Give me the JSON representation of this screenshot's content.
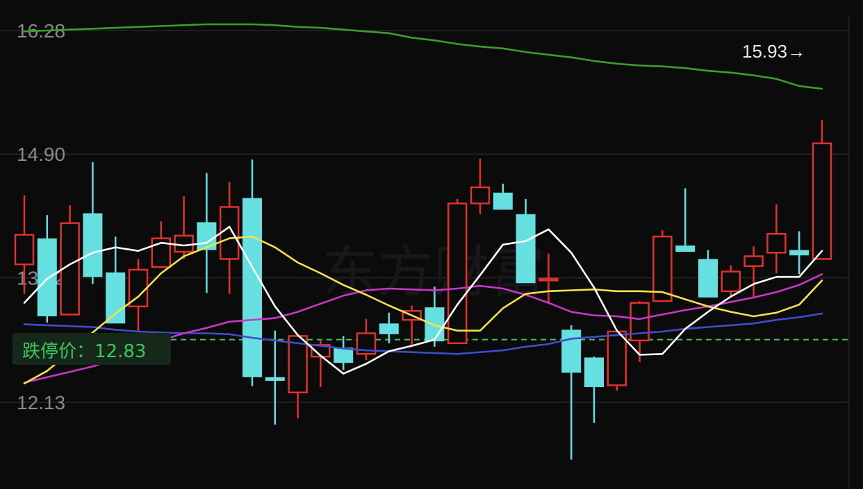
{
  "top_values": [
    {
      "text": "",
      "color": "#3cc85a"
    },
    {
      "text": "",
      "color": "#e6e6e6"
    },
    {
      "text": "",
      "color": "#4a5bff"
    }
  ],
  "limit_line": {
    "label": "跌停价：12.83",
    "value": 12.83,
    "color": "#3cc85a"
  },
  "last_price": {
    "label": "15.93→",
    "value": 15.93
  },
  "watermark": "东方财富",
  "colors": {
    "up": "#e0322b",
    "down": "#66dfe0",
    "ma5": "#ffffff",
    "ma10": "#f5e24a",
    "ma20": "#c837c8",
    "ma60": "#3f4ccc",
    "ma_long": "#3a9e2a",
    "grid": "#262629"
  },
  "chart_data": {
    "type": "candlestick",
    "y_ticks": [
      "16.28",
      "14.90",
      "13.52",
      "12.13"
    ],
    "y_tick_values": [
      16.28,
      14.9,
      13.52,
      12.13
    ],
    "ylim": [
      11.5,
      16.55
    ],
    "grid": true,
    "candles": [
      {
        "o": 13.67,
        "h": 14.44,
        "l": 13.34,
        "c": 14.0,
        "dir": "up"
      },
      {
        "o": 13.96,
        "h": 14.22,
        "l": 13.02,
        "c": 13.09,
        "dir": "down"
      },
      {
        "o": 13.11,
        "h": 14.33,
        "l": 13.11,
        "c": 14.13,
        "dir": "up"
      },
      {
        "o": 14.24,
        "h": 14.81,
        "l": 13.45,
        "c": 13.53,
        "dir": "down"
      },
      {
        "o": 13.58,
        "h": 13.98,
        "l": 13.03,
        "c": 13.01,
        "dir": "down"
      },
      {
        "o": 13.2,
        "h": 13.73,
        "l": 12.92,
        "c": 13.61,
        "dir": "up"
      },
      {
        "o": 13.64,
        "h": 14.15,
        "l": 13.64,
        "c": 13.96,
        "dir": "up"
      },
      {
        "o": 13.81,
        "h": 14.43,
        "l": 13.73,
        "c": 13.99,
        "dir": "up"
      },
      {
        "o": 14.14,
        "h": 14.69,
        "l": 13.35,
        "c": 13.83,
        "dir": "down"
      },
      {
        "o": 13.73,
        "h": 14.59,
        "l": 13.34,
        "c": 14.31,
        "dir": "up"
      },
      {
        "o": 14.41,
        "h": 14.84,
        "l": 12.31,
        "c": 12.41,
        "dir": "down"
      },
      {
        "o": 12.41,
        "h": 12.93,
        "l": 11.88,
        "c": 12.37,
        "dir": "down"
      },
      {
        "o": 12.24,
        "h": 12.89,
        "l": 11.95,
        "c": 12.87,
        "dir": "up"
      },
      {
        "o": 12.64,
        "h": 12.83,
        "l": 12.3,
        "c": 12.77,
        "dir": "up"
      },
      {
        "o": 12.74,
        "h": 12.87,
        "l": 12.49,
        "c": 12.57,
        "dir": "down"
      },
      {
        "o": 12.67,
        "h": 13.06,
        "l": 12.6,
        "c": 12.9,
        "dir": "up"
      },
      {
        "o": 13.01,
        "h": 13.13,
        "l": 12.79,
        "c": 12.89,
        "dir": "down"
      },
      {
        "o": 13.05,
        "h": 13.21,
        "l": 12.76,
        "c": 13.15,
        "dir": "up"
      },
      {
        "o": 12.81,
        "h": 13.42,
        "l": 12.75,
        "c": 13.19,
        "dir": "down"
      },
      {
        "o": 12.79,
        "h": 14.4,
        "l": 12.79,
        "c": 14.35,
        "dir": "up"
      },
      {
        "o": 14.35,
        "h": 14.85,
        "l": 14.23,
        "c": 14.53,
        "dir": "up"
      },
      {
        "o": 14.47,
        "h": 14.57,
        "l": 14.28,
        "c": 14.28,
        "dir": "down"
      },
      {
        "o": 14.23,
        "h": 14.4,
        "l": 13.46,
        "c": 13.46,
        "dir": "down"
      },
      {
        "o": 13.51,
        "h": 13.79,
        "l": 13.24,
        "c": 13.49,
        "dir": "up"
      },
      {
        "o": 12.94,
        "h": 12.99,
        "l": 11.49,
        "c": 12.46,
        "dir": "down"
      },
      {
        "o": 12.63,
        "h": 12.64,
        "l": 11.9,
        "c": 12.3,
        "dir": "down"
      },
      {
        "o": 12.32,
        "h": 12.94,
        "l": 12.26,
        "c": 12.92,
        "dir": "up"
      },
      {
        "o": 12.82,
        "h": 13.26,
        "l": 12.58,
        "c": 13.24,
        "dir": "up"
      },
      {
        "o": 13.26,
        "h": 14.05,
        "l": 13.25,
        "c": 13.98,
        "dir": "up"
      },
      {
        "o": 13.88,
        "h": 14.52,
        "l": 13.83,
        "c": 13.81,
        "dir": "down"
      },
      {
        "o": 13.73,
        "h": 13.83,
        "l": 13.32,
        "c": 13.3,
        "dir": "down"
      },
      {
        "o": 13.59,
        "h": 13.66,
        "l": 13.3,
        "c": 13.37,
        "dir": "up"
      },
      {
        "o": 13.76,
        "h": 13.87,
        "l": 13.29,
        "c": 13.65,
        "dir": "up"
      },
      {
        "o": 14.01,
        "h": 14.34,
        "l": 13.57,
        "c": 13.8,
        "dir": "up"
      },
      {
        "o": 13.77,
        "h": 14.04,
        "l": 13.56,
        "c": 13.83,
        "dir": "down"
      },
      {
        "o": 13.73,
        "h": 15.28,
        "l": 13.73,
        "c": 15.02,
        "dir": "up"
      }
    ],
    "series": [
      {
        "key": "ma5",
        "values": [
          13.24,
          13.51,
          13.67,
          13.8,
          13.86,
          13.82,
          13.91,
          13.88,
          13.91,
          14.09,
          13.64,
          13.2,
          12.88,
          12.65,
          12.45,
          12.56,
          12.7,
          12.76,
          12.83,
          13.22,
          13.55,
          13.89,
          13.93,
          14.06,
          13.8,
          13.41,
          12.93,
          12.66,
          12.67,
          12.95,
          13.14,
          13.31,
          13.45,
          13.53,
          13.53,
          13.82
        ]
      },
      {
        "key": "ma10",
        "values": [
          12.34,
          12.48,
          12.69,
          12.91,
          13.12,
          13.31,
          13.57,
          13.76,
          13.86,
          13.96,
          13.98,
          13.86,
          13.69,
          13.57,
          13.44,
          13.33,
          13.21,
          13.1,
          12.99,
          12.93,
          12.93,
          13.18,
          13.34,
          13.37,
          13.38,
          13.39,
          13.37,
          13.37,
          13.36,
          13.28,
          13.2,
          13.14,
          13.09,
          13.13,
          13.22,
          13.49
        ]
      },
      {
        "key": "ma20",
        "values": [
          12.35,
          12.41,
          12.47,
          12.53,
          12.61,
          12.72,
          12.82,
          12.9,
          12.96,
          13.03,
          13.05,
          13.07,
          13.14,
          13.23,
          13.32,
          13.38,
          13.4,
          13.39,
          13.38,
          13.4,
          13.43,
          13.4,
          13.33,
          13.24,
          13.14,
          13.1,
          13.09,
          13.06,
          13.11,
          13.16,
          13.2,
          13.25,
          13.3,
          13.36,
          13.44,
          13.56
        ]
      },
      {
        "key": "ma60",
        "values": [
          13.0,
          12.99,
          12.98,
          12.97,
          12.94,
          12.92,
          12.91,
          12.9,
          12.9,
          12.89,
          12.85,
          12.82,
          12.79,
          12.76,
          12.73,
          12.71,
          12.7,
          12.69,
          12.68,
          12.67,
          12.69,
          12.71,
          12.75,
          12.78,
          12.84,
          12.86,
          12.88,
          12.9,
          12.92,
          12.95,
          12.97,
          12.99,
          13.01,
          13.05,
          13.08,
          13.12
        ]
      },
      {
        "key": "ma_long",
        "values": [
          16.27,
          16.28,
          16.29,
          16.3,
          16.31,
          16.32,
          16.33,
          16.34,
          16.35,
          16.35,
          16.35,
          16.34,
          16.32,
          16.31,
          16.29,
          16.27,
          16.25,
          16.2,
          16.17,
          16.13,
          16.1,
          16.08,
          16.04,
          16.01,
          15.98,
          15.94,
          15.91,
          15.89,
          15.88,
          15.86,
          15.83,
          15.81,
          15.78,
          15.74,
          15.66,
          15.63
        ]
      }
    ]
  }
}
